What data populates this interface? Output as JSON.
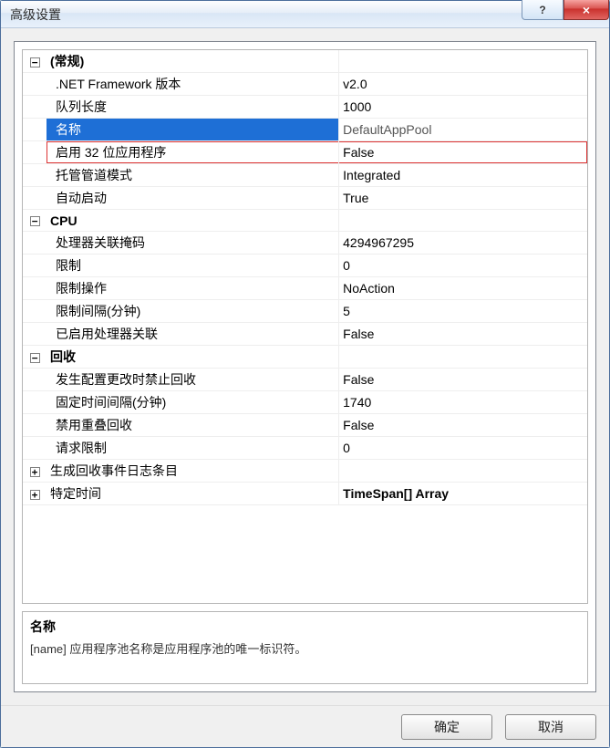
{
  "window": {
    "title": "高级设置",
    "help_glyph": "?",
    "close_glyph": "×"
  },
  "grid": {
    "expand_minus": "−",
    "expand_plus": "+",
    "groups": [
      {
        "key": "general",
        "label": "(常规)",
        "expanded": true,
        "items": [
          {
            "name": ".NET Framework 版本",
            "value": "v2.0"
          },
          {
            "name": "队列长度",
            "value": "1000"
          },
          {
            "name": "名称",
            "value": "DefaultAppPool",
            "selected": true
          },
          {
            "name": "启用 32 位应用程序",
            "value": "False",
            "highlight": true
          },
          {
            "name": "托管管道模式",
            "value": "Integrated"
          },
          {
            "name": "自动启动",
            "value": "True"
          }
        ]
      },
      {
        "key": "cpu",
        "label": "CPU",
        "expanded": true,
        "items": [
          {
            "name": "处理器关联掩码",
            "value": "4294967295"
          },
          {
            "name": "限制",
            "value": "0"
          },
          {
            "name": "限制操作",
            "value": "NoAction"
          },
          {
            "name": "限制间隔(分钟)",
            "value": "5"
          },
          {
            "name": "已启用处理器关联",
            "value": "False"
          }
        ]
      },
      {
        "key": "recycling",
        "label": "回收",
        "expanded": true,
        "items": [
          {
            "name": "发生配置更改时禁止回收",
            "value": "False"
          },
          {
            "name": "固定时间间隔(分钟)",
            "value": "1740"
          },
          {
            "name": "禁用重叠回收",
            "value": "False"
          },
          {
            "name": "请求限制",
            "value": "0"
          }
        ]
      },
      {
        "key": "eventlog",
        "label": "生成回收事件日志条目",
        "expanded": false,
        "items": []
      },
      {
        "key": "specific",
        "label": "特定时间",
        "expanded": false,
        "value": "TimeSpan[] Array",
        "valueBold": true,
        "items": []
      }
    ]
  },
  "description": {
    "title": "名称",
    "body": "[name] 应用程序池名称是应用程序池的唯一标识符。"
  },
  "buttons": {
    "ok": "确定",
    "cancel": "取消"
  }
}
